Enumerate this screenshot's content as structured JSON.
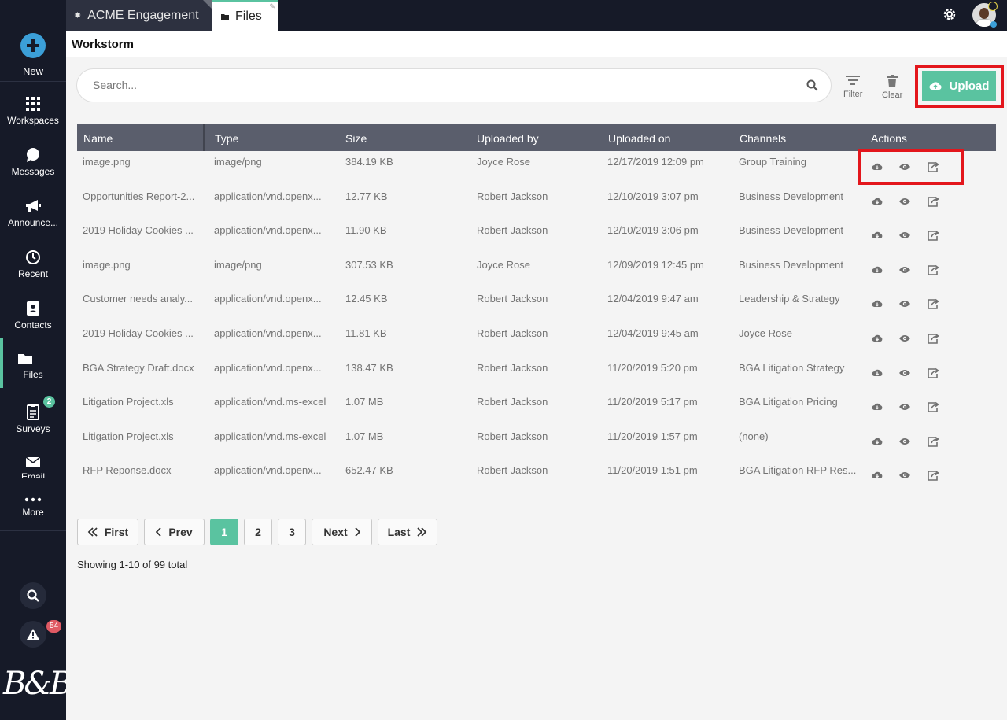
{
  "tabs": [
    {
      "label": "ACME Engagement",
      "icon": "gear-icon"
    },
    {
      "label": "Files",
      "icon": "folder-icon"
    }
  ],
  "sidebar": {
    "new_label": "New",
    "items": [
      {
        "label": "Workspaces",
        "icon": "grid-icon"
      },
      {
        "label": "Messages",
        "icon": "chat-icon"
      },
      {
        "label": "Announce...",
        "icon": "megaphone-icon"
      },
      {
        "label": "Recent",
        "icon": "clock-icon"
      },
      {
        "label": "Contacts",
        "icon": "contact-card-icon"
      },
      {
        "label": "Files",
        "icon": "folder-icon"
      },
      {
        "label": "Surveys",
        "icon": "clipboard-icon",
        "badge": "2"
      },
      {
        "label": "Email",
        "icon": "envelope-icon"
      },
      {
        "label": "More",
        "icon": "ellipsis-icon"
      }
    ],
    "alert_badge": "54",
    "logo_text": "B&B"
  },
  "header": {
    "title": "Workstorm"
  },
  "search": {
    "placeholder": "Search..."
  },
  "toolbar": {
    "filter_label": "Filter",
    "clear_label": "Clear",
    "upload_label": "Upload"
  },
  "table": {
    "columns": [
      "Name",
      "Type",
      "Size",
      "Uploaded by",
      "Uploaded on",
      "Channels",
      "Actions"
    ],
    "rows": [
      {
        "name": "image.png",
        "type": "image/png",
        "size": "384.19 KB",
        "by": "Joyce Rose",
        "on": "12/17/2019 12:09 pm",
        "channel": "Group Training"
      },
      {
        "name": "Opportunities Report-2...",
        "type": "application/vnd.openx...",
        "size": "12.77 KB",
        "by": "Robert Jackson",
        "on": "12/10/2019 3:07 pm",
        "channel": "Business Development"
      },
      {
        "name": "2019 Holiday Cookies ...",
        "type": "application/vnd.openx...",
        "size": "11.90 KB",
        "by": "Robert Jackson",
        "on": "12/10/2019 3:06 pm",
        "channel": "Business Development"
      },
      {
        "name": "image.png",
        "type": "image/png",
        "size": "307.53 KB",
        "by": "Joyce Rose",
        "on": "12/09/2019 12:45 pm",
        "channel": "Business Development"
      },
      {
        "name": "Customer needs analy...",
        "type": "application/vnd.openx...",
        "size": "12.45 KB",
        "by": "Robert Jackson",
        "on": "12/04/2019 9:47 am",
        "channel": "Leadership & Strategy"
      },
      {
        "name": "2019 Holiday Cookies ...",
        "type": "application/vnd.openx...",
        "size": "11.81 KB",
        "by": "Robert Jackson",
        "on": "12/04/2019 9:45 am",
        "channel": "Joyce Rose"
      },
      {
        "name": "BGA Strategy Draft.docx",
        "type": "application/vnd.openx...",
        "size": "138.47 KB",
        "by": "Robert Jackson",
        "on": "11/20/2019 5:20 pm",
        "channel": "BGA Litigation Strategy"
      },
      {
        "name": "Litigation Project.xls",
        "type": "application/vnd.ms-excel",
        "size": "1.07 MB",
        "by": "Robert Jackson",
        "on": "11/20/2019 5:17 pm",
        "channel": "BGA Litigation Pricing"
      },
      {
        "name": "Litigation Project.xls",
        "type": "application/vnd.ms-excel",
        "size": "1.07 MB",
        "by": "Robert Jackson",
        "on": "11/20/2019 1:57 pm",
        "channel": "(none)"
      },
      {
        "name": "RFP Reponse.docx",
        "type": "application/vnd.openx...",
        "size": "652.47 KB",
        "by": "Robert Jackson",
        "on": "11/20/2019 1:51 pm",
        "channel": "BGA Litigation RFP Res..."
      }
    ]
  },
  "pagination": {
    "first_label": "First",
    "prev_label": "Prev",
    "pages": [
      "1",
      "2",
      "3"
    ],
    "current_page": "1",
    "next_label": "Next",
    "last_label": "Last",
    "showing_text": "Showing 1-10 of 99 total"
  },
  "colors": {
    "accent": "#5ac3a0",
    "sidebar_bg": "#161a28",
    "highlight": "#e3161c",
    "header_row": "#5a5e6c"
  }
}
